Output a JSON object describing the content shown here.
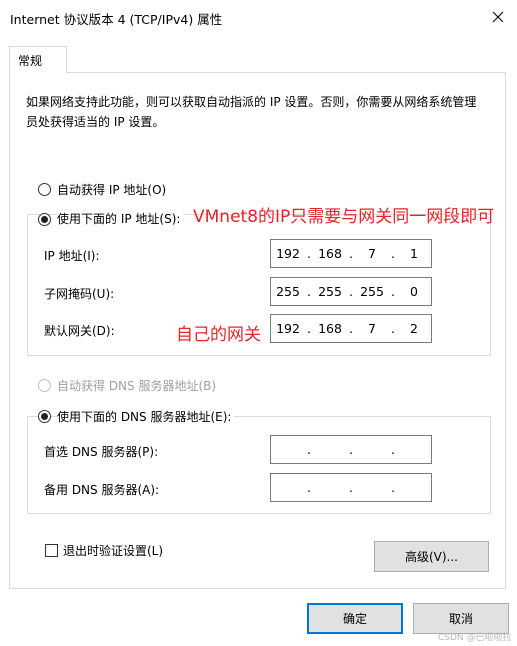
{
  "window": {
    "title": "Internet 协议版本 4 (TCP/IPv4) 属性",
    "close_icon": "close-icon"
  },
  "tabs": [
    {
      "label": "常规",
      "selected": true
    }
  ],
  "description": "如果网络支持此功能，则可以获取自动指派的 IP 设置。否则，你需要从网络系统管理员处获得适当的 IP 设置。",
  "ip_section": {
    "auto_label": "自动获得 IP 地址(O)",
    "manual_label": "使用下面的 IP 地址(S):",
    "selected": "manual",
    "ip_label": "IP 地址(I):",
    "ip_value": [
      "192",
      "168",
      "7",
      "1"
    ],
    "mask_label": "子网掩码(U):",
    "mask_value": [
      "255",
      "255",
      "255",
      "0"
    ],
    "gateway_label": "默认网关(D):",
    "gateway_value": [
      "192",
      "168",
      "7",
      "2"
    ]
  },
  "dns_section": {
    "auto_label": "自动获得 DNS 服务器地址(B)",
    "manual_label": "使用下面的 DNS 服务器地址(E):",
    "selected": "manual",
    "preferred_label": "首选 DNS 服务器(P):",
    "preferred_value": [
      "",
      "",
      "",
      ""
    ],
    "alternate_label": "备用 DNS 服务器(A):",
    "alternate_value": [
      "",
      "",
      "",
      ""
    ]
  },
  "annotations": {
    "ip_note": "VMnet8的IP只需要与网关同一网段即可",
    "gateway_note": "自己的网关",
    "color": "#e8232a"
  },
  "validate_on_exit": {
    "label": "退出时验证设置(L)",
    "checked": false
  },
  "buttons": {
    "advanced": "高级(V)...",
    "ok": "确定",
    "cancel": "取消"
  },
  "watermark": "CSDN @巴啦啦拉"
}
